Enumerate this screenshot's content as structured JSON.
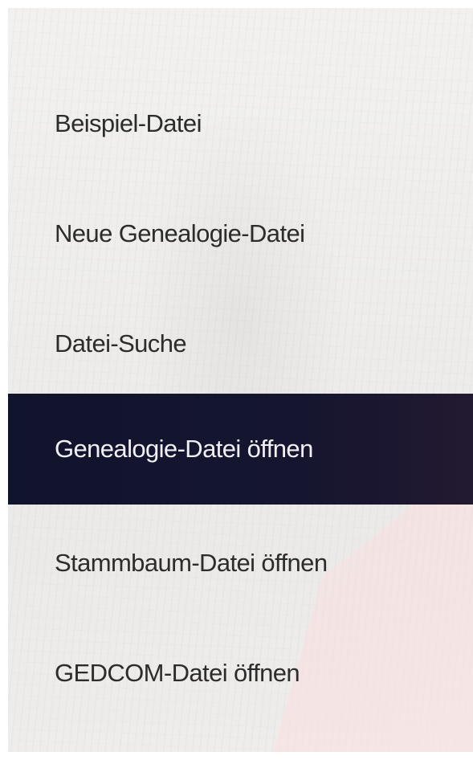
{
  "menu": {
    "items": [
      {
        "label": "Beispiel-Datei"
      },
      {
        "label": "Neue Genealogie-Datei"
      },
      {
        "label": "Datei-Suche"
      },
      {
        "label": "Genealogie-Datei öffnen",
        "selected": true
      },
      {
        "label": "Stammbaum-Datei öffnen"
      },
      {
        "label": "GEDCOM-Datei öffnen"
      }
    ],
    "selected_index": 3
  },
  "colors": {
    "selected_background": "#13152e",
    "selected_text": "#f0f0f4",
    "item_text": "#2c2c2c",
    "panel_background": "#efeeec"
  }
}
